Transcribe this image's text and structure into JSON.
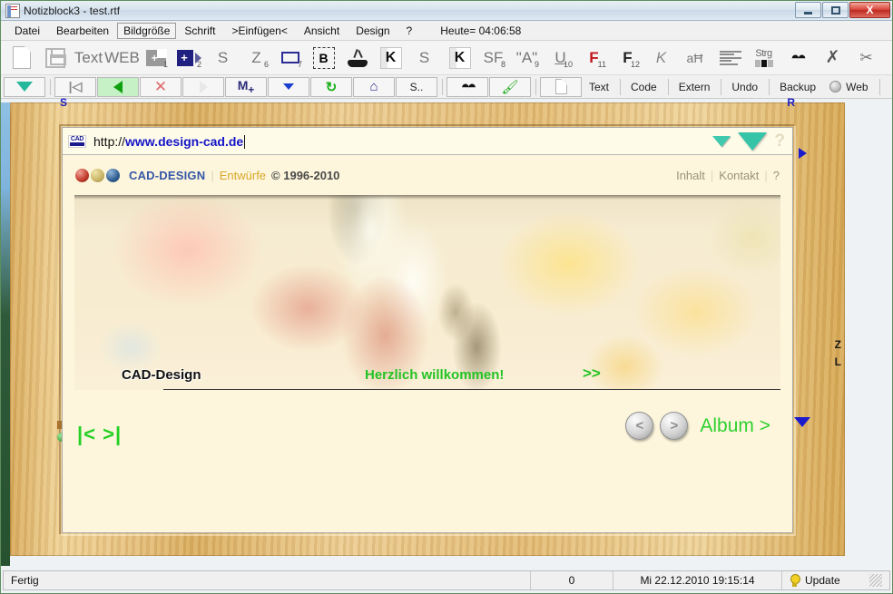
{
  "window": {
    "title": "Notizblock3 - test.rtf",
    "icon": "notepad-icon",
    "buttons": {
      "minimize": "minimize-icon",
      "maximize": "maximize-icon",
      "close": "X"
    }
  },
  "menubar": {
    "items": [
      {
        "label": "Datei",
        "boxed": false
      },
      {
        "label": "Bearbeiten",
        "boxed": false
      },
      {
        "label": "Bildgröße",
        "boxed": true
      },
      {
        "label": "Schrift",
        "boxed": false
      },
      {
        "label": ">Einfügen<",
        "boxed": false
      },
      {
        "label": "Ansicht",
        "boxed": false
      },
      {
        "label": "Design",
        "boxed": false
      },
      {
        "label": "?",
        "boxed": false
      }
    ],
    "clock": "Heute= 04:06:58"
  },
  "toolbar1": {
    "items": [
      {
        "name": "new-document-icon",
        "kind": "newdoc",
        "text": "",
        "sub": ""
      },
      {
        "name": "save-icon",
        "kind": "save",
        "text": "",
        "sub": ""
      },
      {
        "name": "text-icon",
        "kind": "label",
        "text": "Text",
        "sub": ""
      },
      {
        "name": "web-icon",
        "kind": "label",
        "text": "WEB",
        "sub": ""
      },
      {
        "name": "insert-image-1-icon",
        "kind": "img",
        "text": "",
        "sub": "1"
      },
      {
        "name": "insert-image-2-icon",
        "kind": "imgb",
        "text": "",
        "sub": "2"
      },
      {
        "name": "shape-s-icon",
        "kind": "label",
        "text": "S",
        "sub": ""
      },
      {
        "name": "shape-z-6-icon",
        "kind": "label",
        "text": "Z",
        "sub": "6"
      },
      {
        "name": "rectangle-7-icon",
        "kind": "rect",
        "text": "",
        "sub": "7"
      },
      {
        "name": "bold-selection-icon",
        "kind": "bsel",
        "text": "B",
        "sub": ""
      },
      {
        "name": "anvil-icon",
        "kind": "anvil",
        "text": "",
        "sub": ""
      },
      {
        "name": "k-book-icon",
        "kind": "kbook",
        "text": "K",
        "sub": ""
      },
      {
        "name": "shape-s-2-icon",
        "kind": "label",
        "text": "S",
        "sub": ""
      },
      {
        "name": "k-book-2-icon",
        "kind": "kbook",
        "text": "K",
        "sub": ""
      },
      {
        "name": "sf-8-icon",
        "kind": "label",
        "text": "SF",
        "sub": "8"
      },
      {
        "name": "quote-9-icon",
        "kind": "label",
        "text": "\"A\"",
        "sub": "9"
      },
      {
        "name": "underline-10-icon",
        "kind": "label-u",
        "text": "U",
        "sub": "10"
      },
      {
        "name": "f-11-icon",
        "kind": "label-red",
        "text": "F",
        "sub": "11"
      },
      {
        "name": "f-12-icon",
        "kind": "label-bold",
        "text": "F",
        "sub": "12"
      },
      {
        "name": "italic-k-icon",
        "kind": "label-it",
        "text": "K",
        "sub": ""
      },
      {
        "name": "case-icon",
        "kind": "label",
        "text": "aĦ",
        "sub": ""
      },
      {
        "name": "align-icon",
        "kind": "align",
        "text": "",
        "sub": ""
      },
      {
        "name": "strg-icon",
        "kind": "strg",
        "text": "Strg",
        "sub": ""
      },
      {
        "name": "binoculars-icon",
        "kind": "bino",
        "text": "",
        "sub": ""
      },
      {
        "name": "cut-x-icon",
        "kind": "xmark",
        "text": "",
        "sub": ""
      },
      {
        "name": "scissors-icon",
        "kind": "scissors",
        "text": "",
        "sub": ""
      },
      {
        "name": "more-chevron-icon",
        "kind": "chev",
        "text": "",
        "sub": ""
      }
    ]
  },
  "toolbar2": {
    "items": [
      {
        "name": "dropdown-teal-button",
        "kind": "tri-dn",
        "label": ""
      },
      {
        "name": "first-page-button",
        "kind": "first",
        "label": ""
      },
      {
        "name": "previous-page-button",
        "kind": "tri-lf",
        "label": "",
        "highlight": true
      },
      {
        "name": "delete-button",
        "kind": "xred",
        "label": ""
      },
      {
        "name": "next-page-button",
        "kind": "tri-rt-o",
        "label": ""
      },
      {
        "name": "macro-button",
        "kind": "mplus",
        "label": ""
      },
      {
        "name": "dropdown-blue-button",
        "kind": "tri-dn-sm",
        "label": ""
      },
      {
        "name": "refresh-button",
        "kind": "recycle",
        "label": ""
      },
      {
        "name": "home-button",
        "kind": "home",
        "label": ""
      },
      {
        "name": "s-button",
        "kind": "text",
        "label": "S.."
      }
    ],
    "items2": [
      {
        "name": "search-button",
        "kind": "bino",
        "label": ""
      },
      {
        "name": "paint-button",
        "kind": "paint",
        "label": ""
      },
      {
        "name": "page-button",
        "kind": "page",
        "label": ""
      }
    ],
    "tabs": [
      {
        "name": "tab-text",
        "label": "Text"
      },
      {
        "name": "tab-code",
        "label": "Code"
      },
      {
        "name": "tab-extern",
        "label": "Extern"
      },
      {
        "name": "tab-undo",
        "label": "Undo"
      },
      {
        "name": "tab-backup",
        "label": "Backup"
      },
      {
        "name": "tab-web",
        "label": "Web"
      }
    ]
  },
  "frame": {
    "label_top_left": "S",
    "label_top_right": "R",
    "label_right_z": "Z",
    "label_right_l": "L"
  },
  "browser": {
    "url_prefix": "http://",
    "url_bold": "www.design-cad.de",
    "badge": "CAD",
    "help_mark": "?"
  },
  "site": {
    "brand": "CAD-DESIGN",
    "divider": "|",
    "subtitle": "Entwürfe",
    "copyright": "© 1996-2010",
    "nav": [
      {
        "name": "nav-inhalt",
        "label": "Inhalt"
      },
      {
        "name": "nav-kontakt",
        "label": "Kontakt"
      },
      {
        "name": "nav-help",
        "label": "?"
      }
    ],
    "banner": {
      "title": "CAD-Design",
      "welcome": "Herzlich willkommen!",
      "more": ">>"
    },
    "nav_left": "|< >|",
    "album_prev": "<",
    "album_next": ">",
    "album_label": "Album >"
  },
  "statusbar": {
    "status": "Fertig",
    "count": "0",
    "datetime": "Mi 22.12.2010 19:15:14",
    "update": "Update"
  },
  "colors": {
    "accent_blue": "#1414c8",
    "brand_blue": "#3557a8",
    "gold": "#d8a72a",
    "green": "#24c324",
    "frame_wood": "#e2bb76",
    "page_bg": "#fdf6dc"
  }
}
